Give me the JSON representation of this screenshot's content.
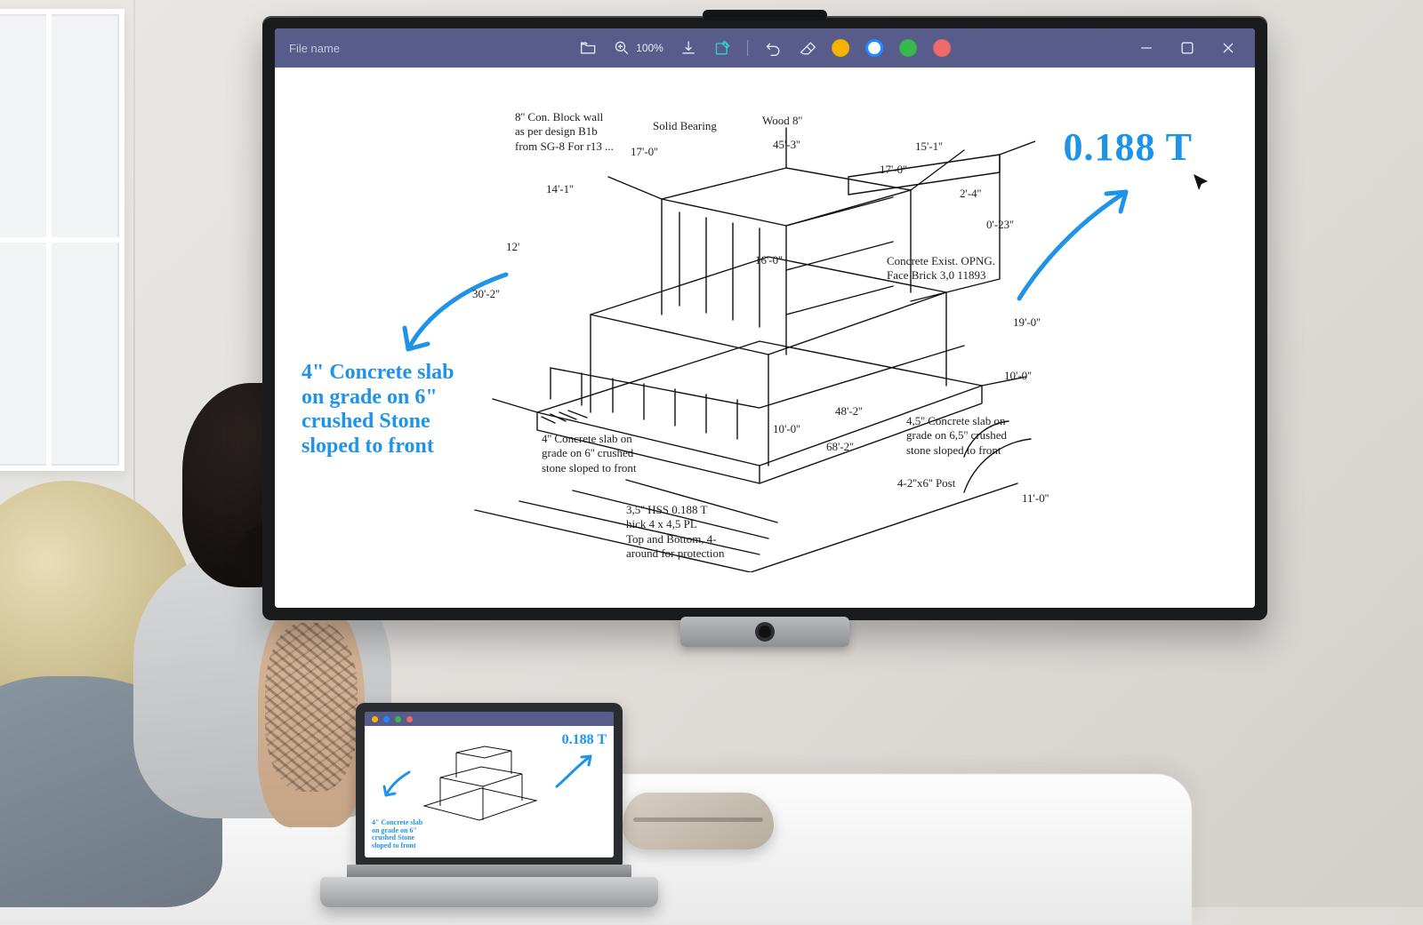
{
  "toolbar": {
    "title": "File name",
    "zoom_label": "100%",
    "colors": {
      "yellow": "#f5b301",
      "blue": "#1d8bff",
      "green": "#38b84f",
      "red": "#ef6a6a"
    }
  },
  "annotation_value": "0.188 T",
  "annotation_note_left": "4\" Concrete slab\non grade on 6\"\ncrushed Stone\nsloped to front",
  "drawing_notes": {
    "block_wall": "8'' Con. Block wall\nas per design B1b\nfrom SG-8 For r13 ...",
    "solid_bearing": "Solid Bearing",
    "wood": "Wood 8''",
    "existing": "Concrete Exist. OPNG.\nFace Brick 3,0  11893",
    "left_slab": "4'' Concrete slab on\ngrade on 6'' crushed\nstone sloped to front",
    "right_slab": "4,5'' Concrete slab on\ngrade on 6,5'' crushed\nstone sloped to front",
    "hss": "3,5'' HSS 0.188 T\nhick 4 x 4,5 PL\nTop and Bottom, 4-\naround for protection",
    "post": "4-2''x6'' Post"
  },
  "dimensions": {
    "d14_1": "14'-1''",
    "d17_0": "17'-0''",
    "d45_3": "45'-3''",
    "d15_1": "15'-1''",
    "d17_0b": "17'-0''",
    "d30_2": "30'-2''",
    "d12": "12'",
    "d16_0": "16'-0''",
    "d2_4": "2'-4''",
    "d0_23": "0'-23''",
    "d19_0": "19'-0''",
    "d10_0": "10'-0''",
    "d48_2": "48'-2''",
    "d10_0b": "10'-0''",
    "d68_2": "68'-2''",
    "d11_0": "11'-0''"
  },
  "laptop": {
    "value": "0.188 T",
    "note": "4\" Concrete slab on grade on 6\" crushed Stone sloped to front"
  }
}
